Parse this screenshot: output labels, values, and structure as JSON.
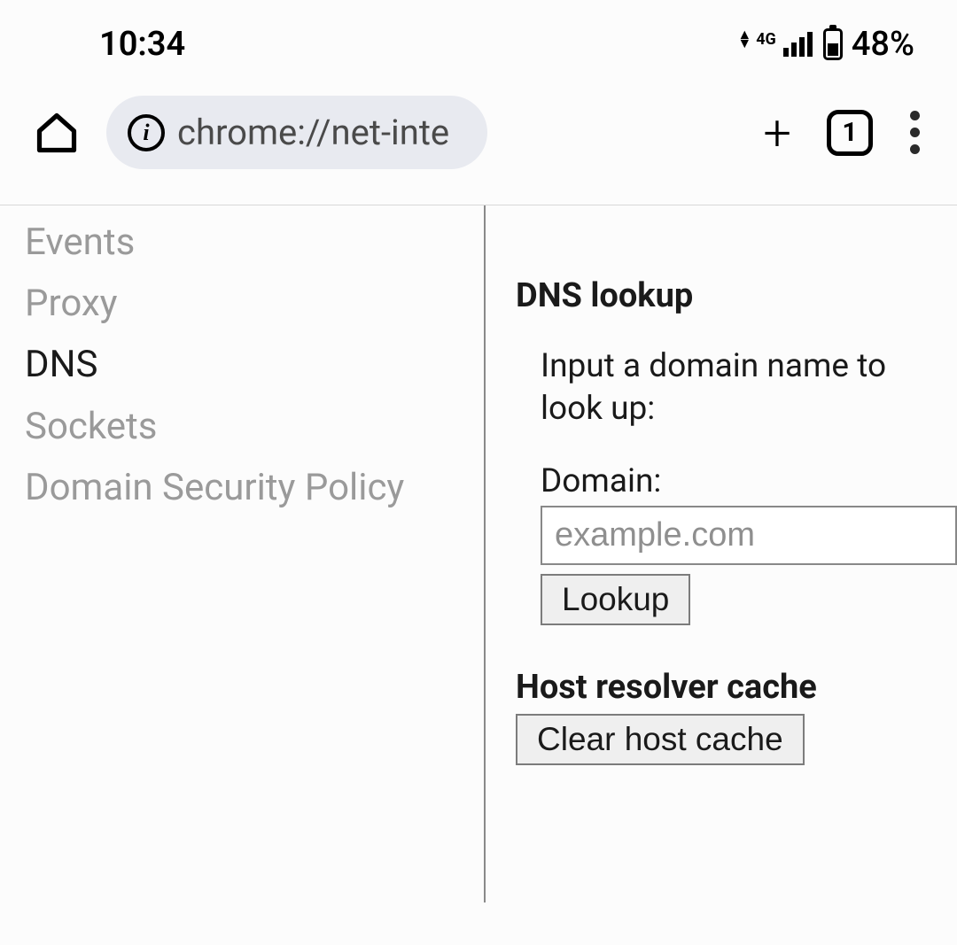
{
  "status": {
    "time": "10:34",
    "network_type": "4G",
    "battery_pct": "48%"
  },
  "toolbar": {
    "url": "chrome://net-inte",
    "tab_count": "1"
  },
  "sidebar": {
    "items": [
      {
        "label": "Events",
        "active": false
      },
      {
        "label": "Proxy",
        "active": false
      },
      {
        "label": "DNS",
        "active": true
      },
      {
        "label": "Sockets",
        "active": false
      },
      {
        "label": "Domain Security Policy",
        "active": false
      }
    ]
  },
  "main": {
    "dns_lookup": {
      "heading": "DNS lookup",
      "instruction": "Input a domain name to look up:",
      "field_label": "Domain:",
      "placeholder": "example.com",
      "lookup_button": "Lookup"
    },
    "host_cache": {
      "heading": "Host resolver cache",
      "clear_button": "Clear host cache"
    }
  }
}
